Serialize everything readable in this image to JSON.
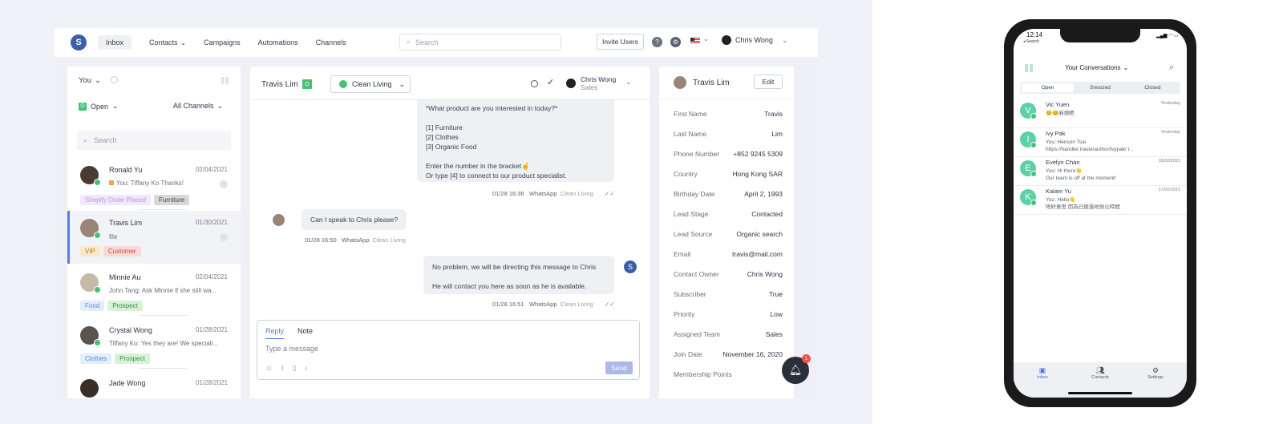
{
  "nav": {
    "items": [
      "Inbox",
      "Contacts",
      "Campaigns",
      "Automations",
      "Channels"
    ],
    "search_placeholder": "Search",
    "invite_label": "Invite Users",
    "user_name": "Chris Wong"
  },
  "list": {
    "assignee": "You",
    "status": "Open",
    "channels": "All Channels",
    "search_placeholder": "Search",
    "rows": [
      {
        "name": "Ronald Yu",
        "date": "02/04/2021",
        "msg": "You: Tiffany Ko Thanks!",
        "tags": [
          "Shopify Order Placed",
          "Furniture"
        ]
      },
      {
        "name": "Travis Lim",
        "date": "01/30/2021",
        "msg": "file",
        "tags": [
          "VIP",
          "Customer"
        ]
      },
      {
        "name": "Minnie Au",
        "date": "02/04/2021",
        "msg": "John Tang: Ask Minnie if she still wa...",
        "tags": [
          "Food",
          "Prospect"
        ]
      },
      {
        "name": "Crystal Wong",
        "date": "01/28/2021",
        "msg": "Tiffany Ko: Yes they are! We speciali...",
        "tags": [
          "Clothes",
          "Prospect"
        ]
      },
      {
        "name": "Jade Wong",
        "date": "01/28/2021",
        "msg": "",
        "tags": []
      }
    ]
  },
  "conversation": {
    "contact_name": "Travis Lim",
    "channel_select": "Clean Living",
    "assignee_name": "Chris Wong",
    "assignee_team": "Sales",
    "messages": {
      "m1_lines": [
        "*What product are you interested in today?*",
        "",
        "[1] Furniture",
        "[2]  Clothes",
        "[3]  Organic Food",
        "",
        "Enter the number in the bracket☝",
        "Or type [4] to connect to our product specialist."
      ],
      "m1_time": "01/28 16:36",
      "m2_text": "Can I speak to Chris please?",
      "m2_time": "01/28 16:50",
      "m3_line1": "No problem, we will be directing this message to Chris",
      "m3_line2": "He will contact you here as soon as he is available.",
      "m3_time": "01/28 16:51",
      "channel_name": "WhatsApp",
      "channel_label": "Clean Living"
    },
    "composer": {
      "tab_reply": "Reply",
      "tab_note": "Note",
      "placeholder": "Type a message",
      "send_label": "Send"
    }
  },
  "info": {
    "name": "Travis Lim",
    "edit_label": "Edit",
    "fields": [
      {
        "k": "First Name",
        "v": "Travis"
      },
      {
        "k": "Last Name",
        "v": "Lim"
      },
      {
        "k": "Phone Number",
        "v": "+852 9245 5309"
      },
      {
        "k": "Country",
        "v": "Hong Kong SAR"
      },
      {
        "k": "Birthday Date",
        "v": "April 2, 1993"
      },
      {
        "k": "Lead Stage",
        "v": "Contacted"
      },
      {
        "k": "Lead Source",
        "v": "Organic search"
      },
      {
        "k": "Email",
        "v": "travis@mail.com"
      },
      {
        "k": "Contact Owner",
        "v": "Chris Wong"
      },
      {
        "k": "Subscriber",
        "v": "True"
      },
      {
        "k": "Priority",
        "v": "Low"
      },
      {
        "k": "Assigned Team",
        "v": "Sales"
      },
      {
        "k": "Join Date",
        "v": "November 16, 2020"
      },
      {
        "k": "Membership Points",
        "v": ""
      }
    ],
    "notification_count": "1"
  },
  "phone": {
    "time": "12:14",
    "back": "◂ Search",
    "title": "Your Conversations",
    "tabs": [
      "Open",
      "Snoozed",
      "Closed"
    ],
    "rows": [
      {
        "initial": "V",
        "name": "Vic Yuen",
        "date": "Yesterday",
        "line1": "😊😊麻煩晒",
        "line2": ""
      },
      {
        "initial": "I",
        "name": "Ivy Pak",
        "date": "Yesterday",
        "line1": "You: Henson Tsai",
        "line2": "https://handler.travel/author/ivypak/ i..."
      },
      {
        "initial": "E",
        "name": "Evelyn Chan",
        "date": "18/02/2021",
        "line1": "You: Hi there👋",
        "line2": "Our team is off at the moment!"
      },
      {
        "initial": "K",
        "name": "Kalam Yu",
        "date": "17/02/2021",
        "line1": "You: Hello👋",
        "line2": "唔好意思 因為已經過咗辦公時間"
      }
    ],
    "bottom_nav": [
      "Inbox",
      "Contacts",
      "Settings"
    ]
  },
  "colors": {
    "accent": "#5b7be0",
    "whatsapp": "#46c074",
    "avatar_green": "#5cd0a7",
    "brand": "#3c5fa8"
  }
}
